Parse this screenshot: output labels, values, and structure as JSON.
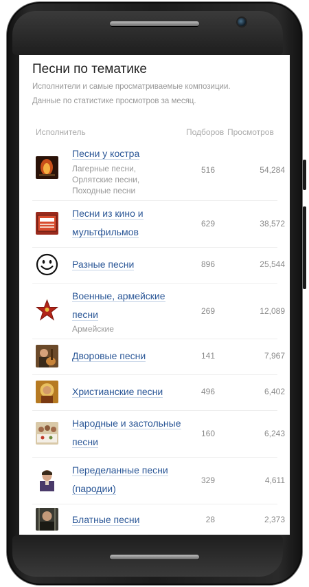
{
  "page": {
    "title": "Песни по тематике",
    "subtitle_line1": "Исполнители и самые просматриваемые композиции.",
    "subtitle_line2": "Данные по статистике просмотров за месяц."
  },
  "table": {
    "headers": {
      "artist": "Исполнитель",
      "selections": "Подборов",
      "views": "Просмотров"
    },
    "rows": [
      {
        "name_lines": [
          "Песни у костра"
        ],
        "desc_lines": [
          "Лагерные песни,",
          "Орлятские песни,",
          "Походные песни"
        ],
        "selections": "516",
        "views": "54,284",
        "icon": "campfire-icon"
      },
      {
        "name_lines": [
          "Песни из кино и",
          "мультфильмов"
        ],
        "desc_lines": [],
        "selections": "629",
        "views": "38,572",
        "icon": "film-songs-badge-icon"
      },
      {
        "name_lines": [
          "Разные песни"
        ],
        "desc_lines": [],
        "selections": "896",
        "views": "25,544",
        "icon": "smiley-icon"
      },
      {
        "name_lines": [
          "Военные, армейские",
          "песни"
        ],
        "desc_lines": [
          "Армейские"
        ],
        "selections": "269",
        "views": "12,089",
        "icon": "red-star-icon"
      },
      {
        "name_lines": [
          "Дворовые песни"
        ],
        "desc_lines": [],
        "selections": "141",
        "views": "7,967",
        "icon": "yard-guitar-icon"
      },
      {
        "name_lines": [
          "Христианские песни"
        ],
        "desc_lines": [],
        "selections": "496",
        "views": "6,402",
        "icon": "icon-painting-icon"
      },
      {
        "name_lines": [
          "Народные и застольные",
          "песни"
        ],
        "desc_lines": [],
        "selections": "160",
        "views": "6,243",
        "icon": "feast-table-icon"
      },
      {
        "name_lines": [
          "Переделанные песни",
          "(пародии)"
        ],
        "desc_lines": [],
        "selections": "329",
        "views": "4,611",
        "icon": "parody-man-icon"
      },
      {
        "name_lines": [
          "Блатные песни"
        ],
        "desc_lines": [],
        "selections": "28",
        "views": "2,373",
        "icon": "prison-man-icon"
      }
    ]
  }
}
